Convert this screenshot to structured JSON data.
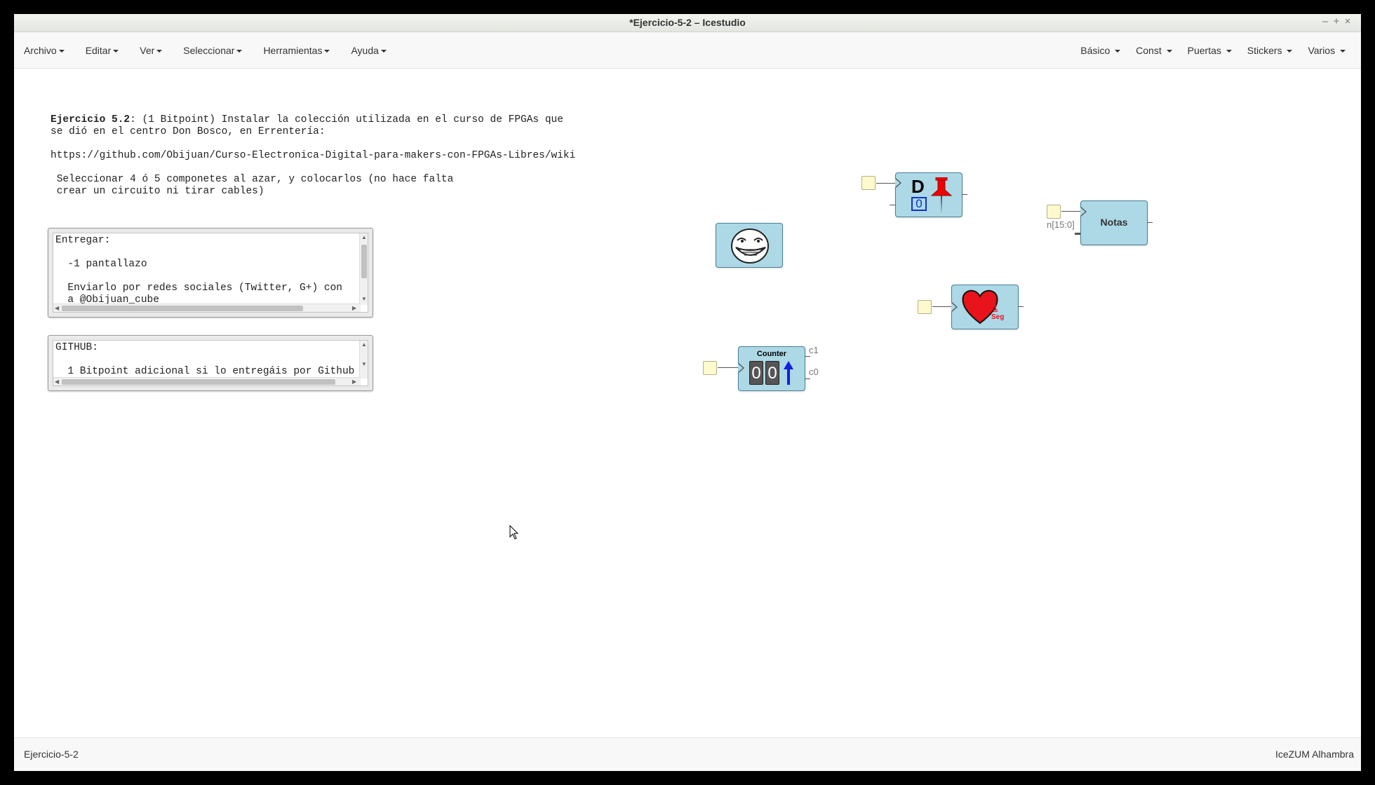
{
  "window": {
    "title": "*Ejercicio-5-2 – Icestudio",
    "controls": [
      "–",
      "+",
      "×"
    ]
  },
  "menubar": {
    "left": [
      "Archivo",
      "Editar",
      "Ver",
      "Seleccionar",
      "Herramientas",
      "Ayuda"
    ],
    "right": [
      "Básico",
      "Const",
      "Puertas",
      "Stickers",
      "Varios"
    ]
  },
  "info": {
    "bold": "Ejercicio 5.2",
    "line1": ": (1 Bitpoint) Instalar la colección utilizada en el curso de FPGAs que",
    "line2": "se dió en el centro Don Bosco, en Errentería:",
    "url": "https://github.com/Obijuan/Curso-Electronica-Digital-para-makers-con-FPGAs-Libres/wiki",
    "select1": "Seleccionar 4 ó 5 componetes al azar, y colocarlos (no hace falta",
    "select2": "crear un circuito ni tirar cables)"
  },
  "memo1": {
    "line1": "Entregar:",
    "line2": "  -1 pantallazo",
    "line3": "  Enviarlo por redes sociales (Twitter, G+) con",
    "line4": "  a @Obijuan_cube"
  },
  "memo2": {
    "line1": "GITHUB:",
    "line2": "  1 Bitpoint adicional si lo entregáis por Github"
  },
  "blocks": {
    "dff_label": "D",
    "dff_value": "0",
    "notas_label": "Notas",
    "notas_port": "n[15:0]",
    "heart_num": "1",
    "heart_unit": "Seg",
    "counter_label": "Counter",
    "counter_digits": [
      "0",
      "0"
    ],
    "counter_out1": "c1",
    "counter_out0": "c0"
  },
  "status": {
    "left": "Ejercicio-5-2",
    "right": "IceZUM Alhambra"
  },
  "colors": {
    "block_fill": "#add8e6",
    "input_port": "#fffacd"
  },
  "icons": [
    "troll-face-icon",
    "push-pin-icon",
    "heart-icon",
    "up-arrow-icon",
    "mouse-cursor-icon"
  ]
}
